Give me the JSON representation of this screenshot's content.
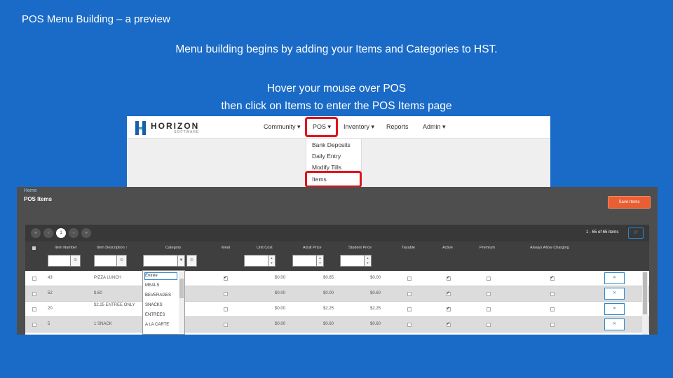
{
  "slide": {
    "title": "POS Menu Building – a preview",
    "line1": "Menu building begins by adding your Items and Categories to HST.",
    "line2": "Hover your mouse over POS",
    "line3": "then click on Items to enter the POS Items page"
  },
  "horizon": {
    "logo": "HORIZON",
    "logo_sub": "SOFTWARE",
    "nav": [
      "Community ▾",
      "POS ▾",
      "Inventory ▾",
      "Reports",
      "Admin ▾"
    ],
    "pos_menu": [
      "Bank Deposits",
      "Daily Entry",
      "Modify Tills",
      "Items"
    ],
    "highlight_color": "#e0121b"
  },
  "pos_items": {
    "breadcrumb": "Home",
    "title": "POS Items",
    "save_label": "Save Items",
    "pager": {
      "first": "«",
      "prev": "‹",
      "current": "1",
      "next": "›",
      "last": "»",
      "info": "1 - 65 of 65 items",
      "refresh": "⟳"
    },
    "columns": [
      "Item Number",
      "Item Description ↑",
      "Category",
      "Meal",
      "Unit Cost",
      "Adult Price",
      "Student Price",
      "Taxable",
      "Active",
      "Premium",
      "Always Allow Charging"
    ],
    "filter_btn": "⊙",
    "spin_up": "▲",
    "spin_down": "▼",
    "edit_label": "✕",
    "category_dropdown": [
      "Entrée",
      "MEALS",
      "BEVERAGES",
      "SNACKS",
      "ENTREES",
      "A LA CARTE"
    ],
    "rows": [
      {
        "num": "43",
        "desc": "PIZZA LUNCH",
        "meal": true,
        "unit": "$0.00",
        "adult": "$0.65",
        "student": "$0.00",
        "taxable": false,
        "active": true,
        "premium": false,
        "always": true
      },
      {
        "num": "52",
        "desc": "$.60",
        "meal": false,
        "unit": "$0.00",
        "adult": "$0.00",
        "student": "$0.60",
        "taxable": false,
        "active": true,
        "premium": false,
        "always": false
      },
      {
        "num": "20",
        "desc": "$2.25 ENTREE ONLY",
        "meal": false,
        "unit": "$0.00",
        "adult": "$2.25",
        "student": "$2.25",
        "taxable": false,
        "active": true,
        "premium": false,
        "always": false
      },
      {
        "num": "5",
        "desc": "1 SNACK",
        "meal": false,
        "unit": "$0.00",
        "adult": "$0.60",
        "student": "$0.60",
        "taxable": false,
        "active": true,
        "premium": false,
        "always": false
      }
    ]
  }
}
